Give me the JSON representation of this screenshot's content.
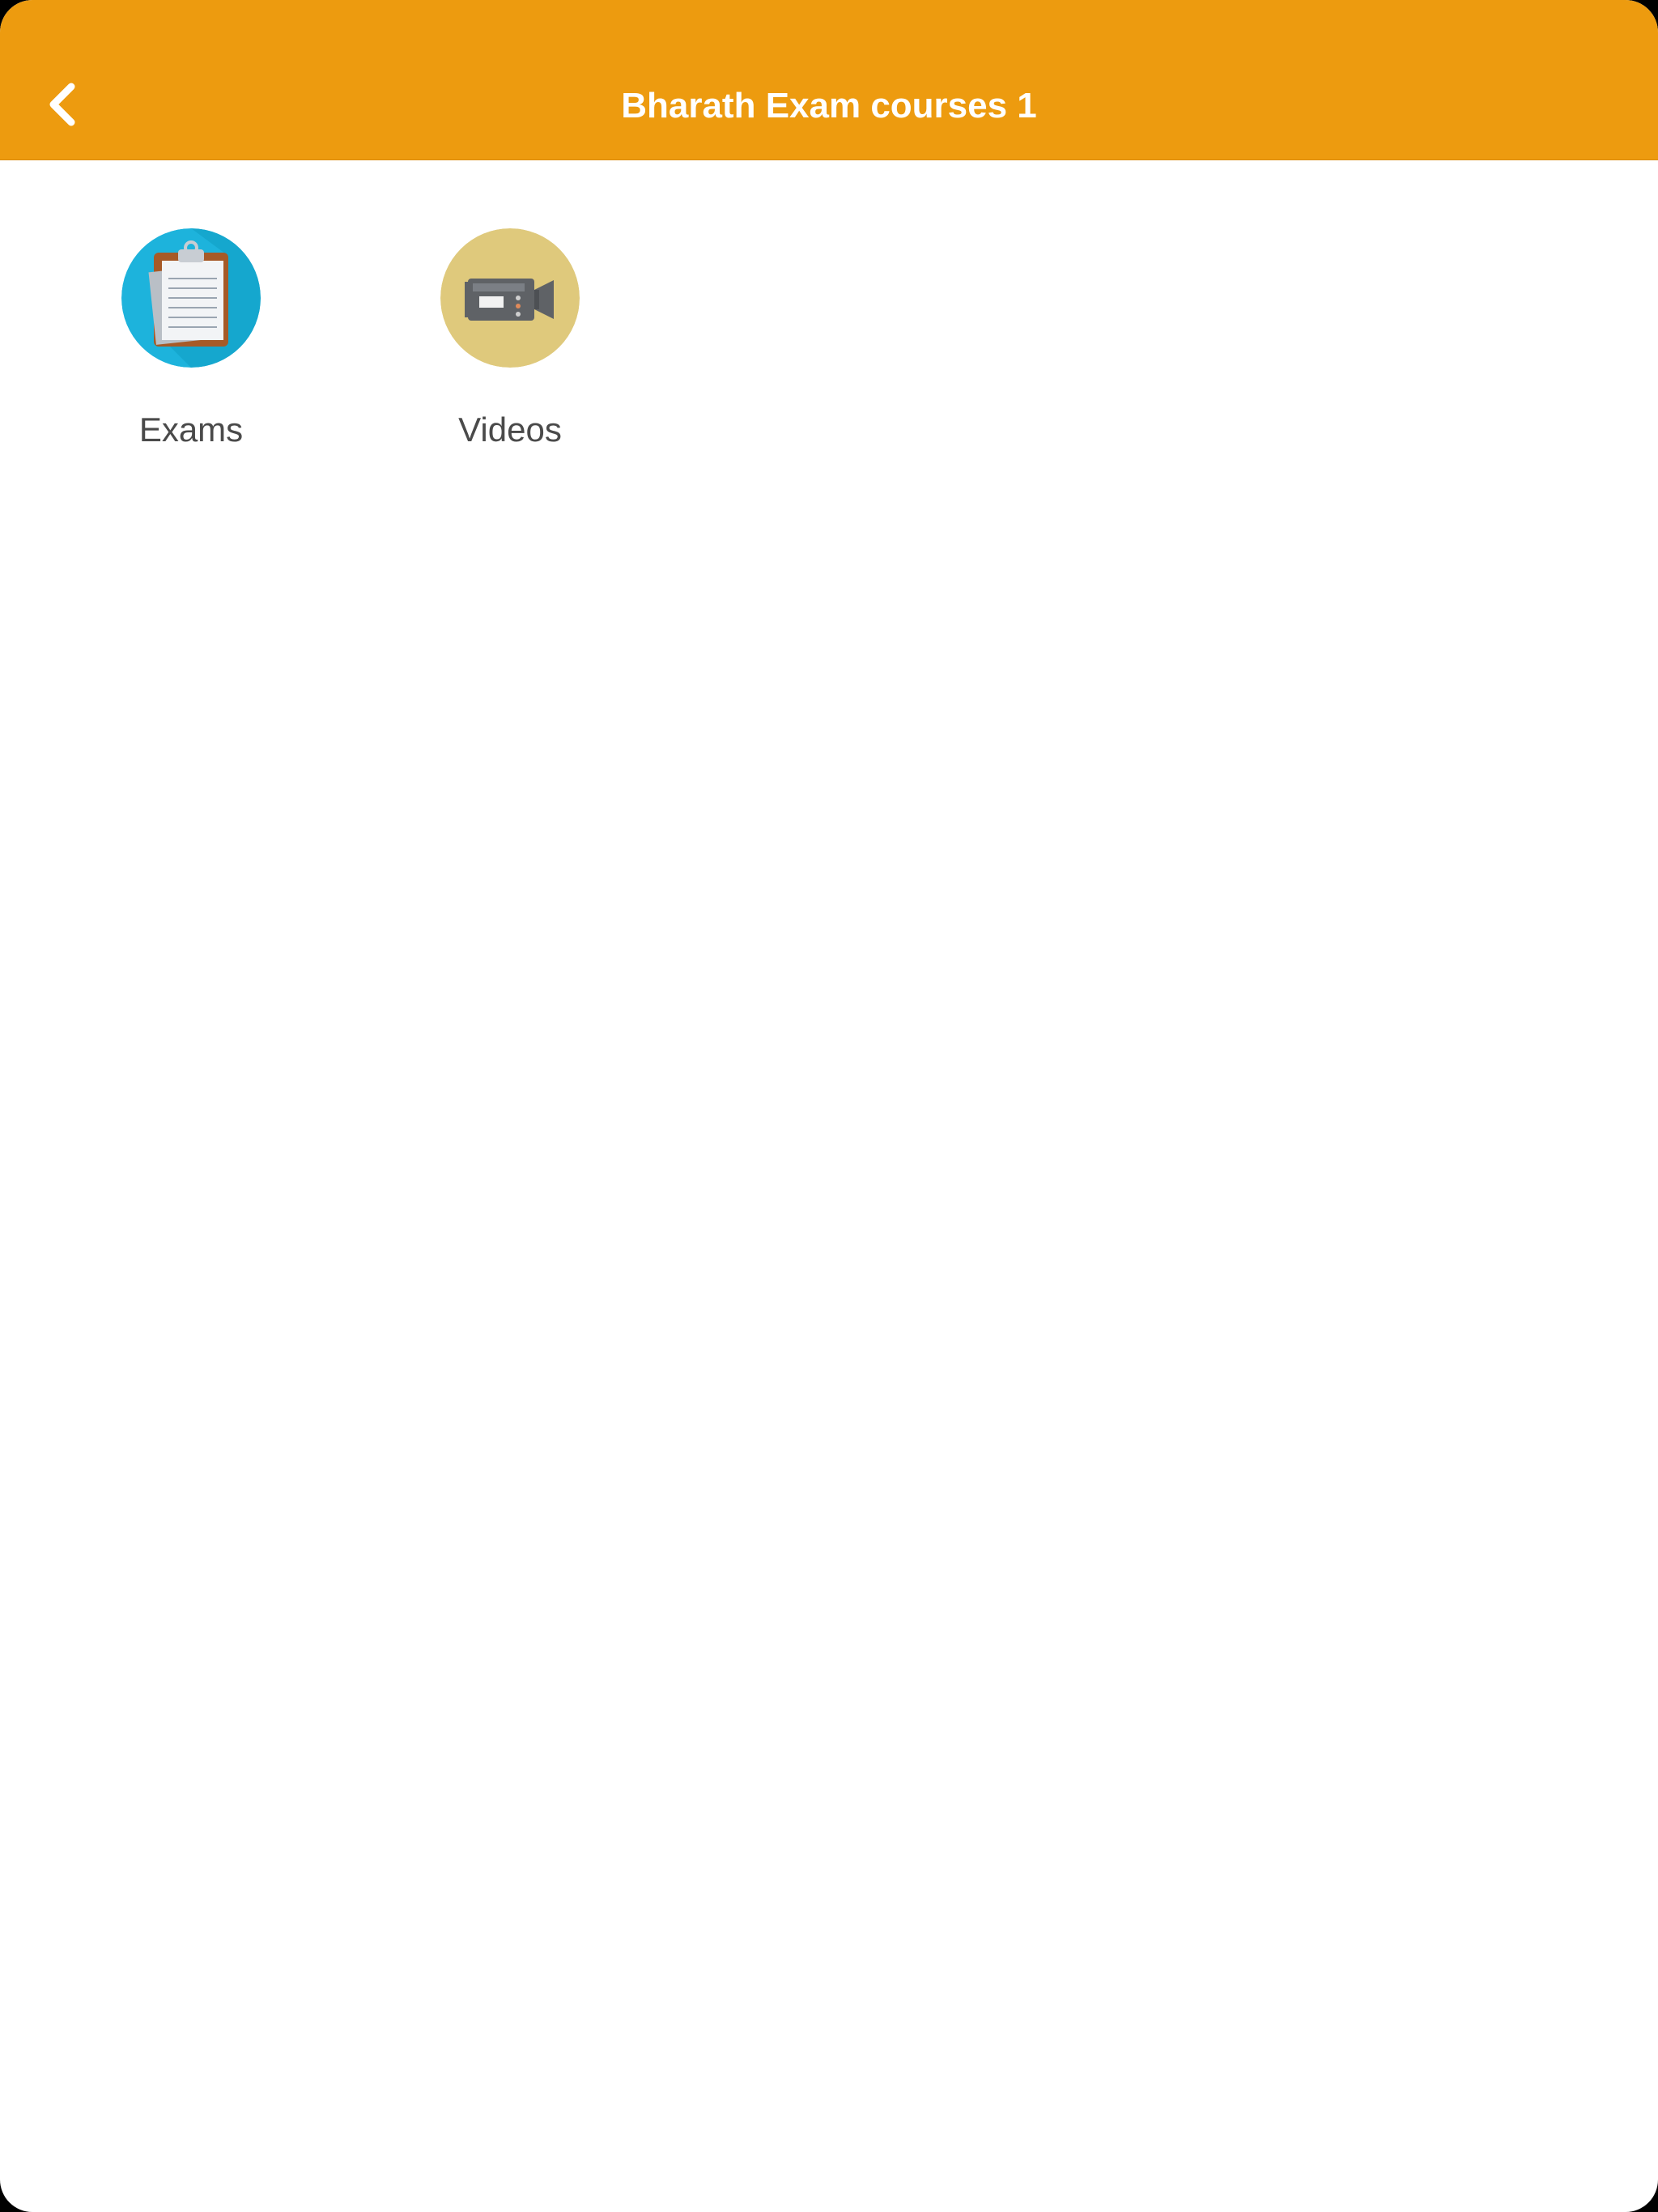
{
  "header": {
    "title": "Bharath Exam courses 1",
    "back_icon": "chevron-left-icon",
    "background_color": "#ed9b0f"
  },
  "tiles": [
    {
      "label": "Exams",
      "icon": "clipboard-icon",
      "circle_color": "#1db3dc"
    },
    {
      "label": "Videos",
      "icon": "video-camera-icon",
      "circle_color": "#dfc97c"
    }
  ]
}
